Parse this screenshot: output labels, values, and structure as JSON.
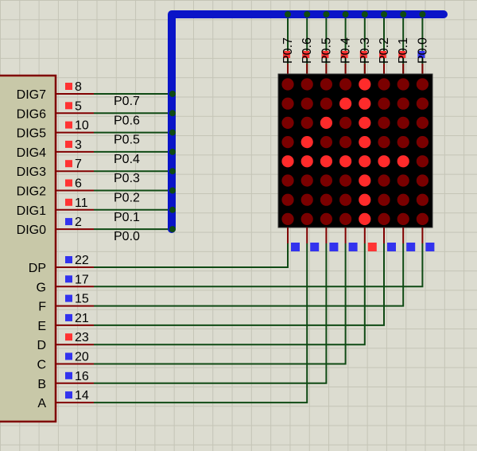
{
  "colors": {
    "bus": "#0a14c8",
    "wire": "#0f4a14",
    "chip_fill": "#c8c8a8",
    "chip_border": "#800000",
    "matrix_bg": "#000000",
    "led_on": "#ff2b2b",
    "led_off": "#7a0000",
    "pin_high": "#ff3333",
    "pin_low": "#3333ee"
  },
  "chip": {
    "digit_pins": [
      {
        "label": "DIG7",
        "number": "8",
        "state": "high"
      },
      {
        "label": "DIG6",
        "number": "5",
        "state": "high"
      },
      {
        "label": "DIG5",
        "number": "10",
        "state": "high"
      },
      {
        "label": "DIG4",
        "number": "3",
        "state": "high"
      },
      {
        "label": "DIG3",
        "number": "7",
        "state": "high"
      },
      {
        "label": "DIG2",
        "number": "6",
        "state": "high"
      },
      {
        "label": "DIG1",
        "number": "11",
        "state": "high"
      },
      {
        "label": "DIG0",
        "number": "2",
        "state": "low"
      }
    ],
    "segment_pins": [
      {
        "label": "DP",
        "number": "22",
        "state": "low"
      },
      {
        "label": "G",
        "number": "17",
        "state": "low"
      },
      {
        "label": "F",
        "number": "15",
        "state": "low"
      },
      {
        "label": "E",
        "number": "21",
        "state": "low"
      },
      {
        "label": "D",
        "number": "23",
        "state": "high"
      },
      {
        "label": "C",
        "number": "20",
        "state": "low"
      },
      {
        "label": "B",
        "number": "16",
        "state": "low"
      },
      {
        "label": "A",
        "number": "14",
        "state": "low"
      }
    ]
  },
  "net_labels": [
    "P0.7",
    "P0.6",
    "P0.5",
    "P0.4",
    "P0.3",
    "P0.2",
    "P0.1",
    "P0.0"
  ],
  "matrix": {
    "column_labels": [
      "P0.7",
      "P0.6",
      "P0.5",
      "P0.4",
      "P0.3",
      "P0.2",
      "P0.1",
      "P0.0"
    ],
    "top_pin_states": [
      "high",
      "high",
      "high",
      "high",
      "high",
      "high",
      "high",
      "low"
    ],
    "bottom_pin_states": [
      "low",
      "low",
      "low",
      "low",
      "high",
      "low",
      "low",
      "low"
    ],
    "leds": [
      [
        0,
        0,
        0,
        0,
        1,
        0,
        0,
        0
      ],
      [
        0,
        0,
        0,
        1,
        1,
        0,
        0,
        0
      ],
      [
        0,
        0,
        1,
        0,
        1,
        0,
        0,
        0
      ],
      [
        0,
        1,
        0,
        0,
        1,
        0,
        0,
        0
      ],
      [
        1,
        1,
        1,
        1,
        1,
        1,
        1,
        0
      ],
      [
        0,
        0,
        0,
        0,
        1,
        0,
        0,
        0
      ],
      [
        0,
        0,
        0,
        0,
        1,
        0,
        0,
        0
      ],
      [
        0,
        0,
        0,
        0,
        1,
        0,
        0,
        0
      ]
    ]
  }
}
